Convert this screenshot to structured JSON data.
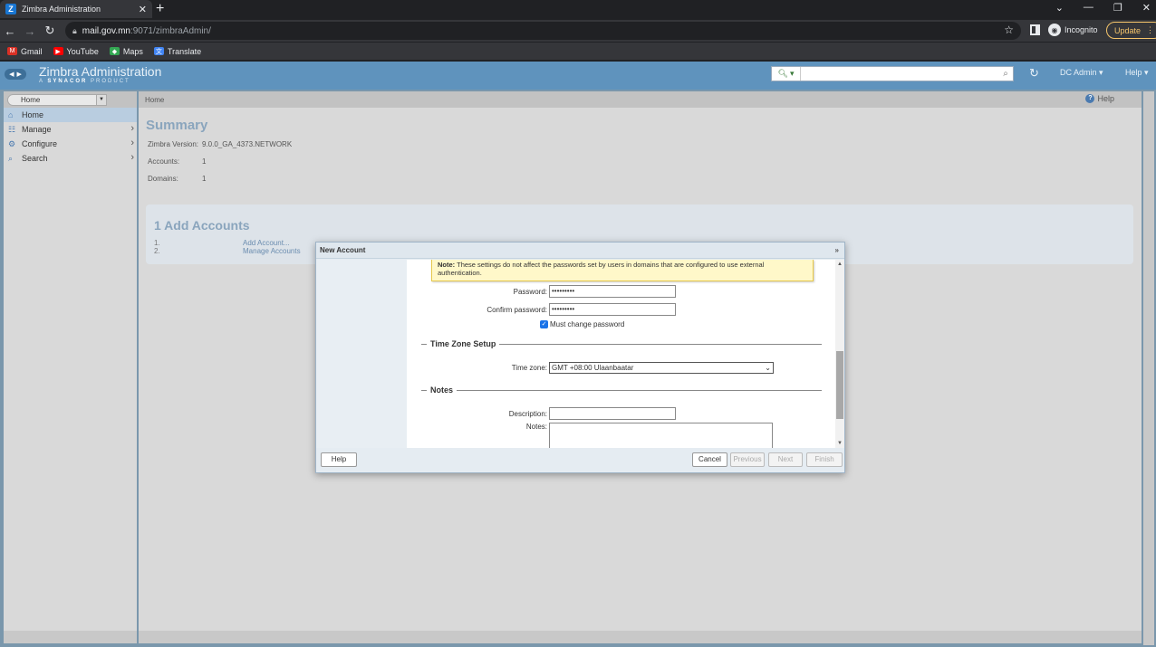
{
  "browser": {
    "tab_title": "Zimbra Administration",
    "favicon_letter": "Z",
    "new_tab": "+",
    "url_host": "mail.gov.mn",
    "url_path": ":9071/zimbraAdmin/",
    "incognito_label": "Incognito",
    "update_label": "Update",
    "bookmarks": [
      {
        "label": "Gmail",
        "icon": "gmail-icon",
        "color": "#d93025"
      },
      {
        "label": "YouTube",
        "icon": "youtube-icon",
        "color": "#ff0000"
      },
      {
        "label": "Maps",
        "icon": "maps-icon",
        "color": "#34a853"
      },
      {
        "label": "Translate",
        "icon": "translate-icon",
        "color": "#4285f4"
      }
    ]
  },
  "header": {
    "title": "Zimbra Administration",
    "subtitle_prefix": "A",
    "subtitle_brand": "SYNACOR",
    "subtitle_suffix": "PRODUCT",
    "user": "DC Admin",
    "help": "Help",
    "accent": "#5f93bd"
  },
  "sidebar": {
    "selector": "Home",
    "items": [
      {
        "label": "Home",
        "icon": "home-icon",
        "active": true
      },
      {
        "label": "Manage",
        "icon": "manage-icon",
        "active": false
      },
      {
        "label": "Configure",
        "icon": "configure-icon",
        "active": false
      },
      {
        "label": "Search",
        "icon": "search-icon",
        "active": false
      }
    ]
  },
  "main": {
    "breadcrumb": "Home",
    "help": "Help",
    "summary_title": "Summary",
    "summary": [
      {
        "label": "Zimbra Version:",
        "value": "9.0.0_GA_4373.NETWORK"
      },
      {
        "label": "Accounts:",
        "value": "1"
      },
      {
        "label": "Domains:",
        "value": "1"
      }
    ],
    "add_title": "1 Add Accounts",
    "add_steps": [
      {
        "num": "1.",
        "label": "Add Account..."
      },
      {
        "num": "2.",
        "label": "Manage Accounts"
      }
    ]
  },
  "dialog": {
    "title": "New Account",
    "note_bold": "Note:",
    "note_text": "These settings do not affect the passwords set by users in domains that are configured to use external authentication.",
    "password_label": "Password:",
    "password_value": "•••••••••",
    "confirm_label": "Confirm password:",
    "confirm_value": "•••••••••",
    "must_change_label": "Must change password",
    "tz_section": "Time Zone Setup",
    "tz_label": "Time zone:",
    "tz_value": "GMT +08:00 Ulaanbaatar",
    "notes_section": "Notes",
    "description_label": "Description:",
    "description_value": "",
    "notes_label": "Notes:",
    "buttons": {
      "help": "Help",
      "cancel": "Cancel",
      "previous": "Previous",
      "next": "Next",
      "finish": "Finish"
    }
  }
}
